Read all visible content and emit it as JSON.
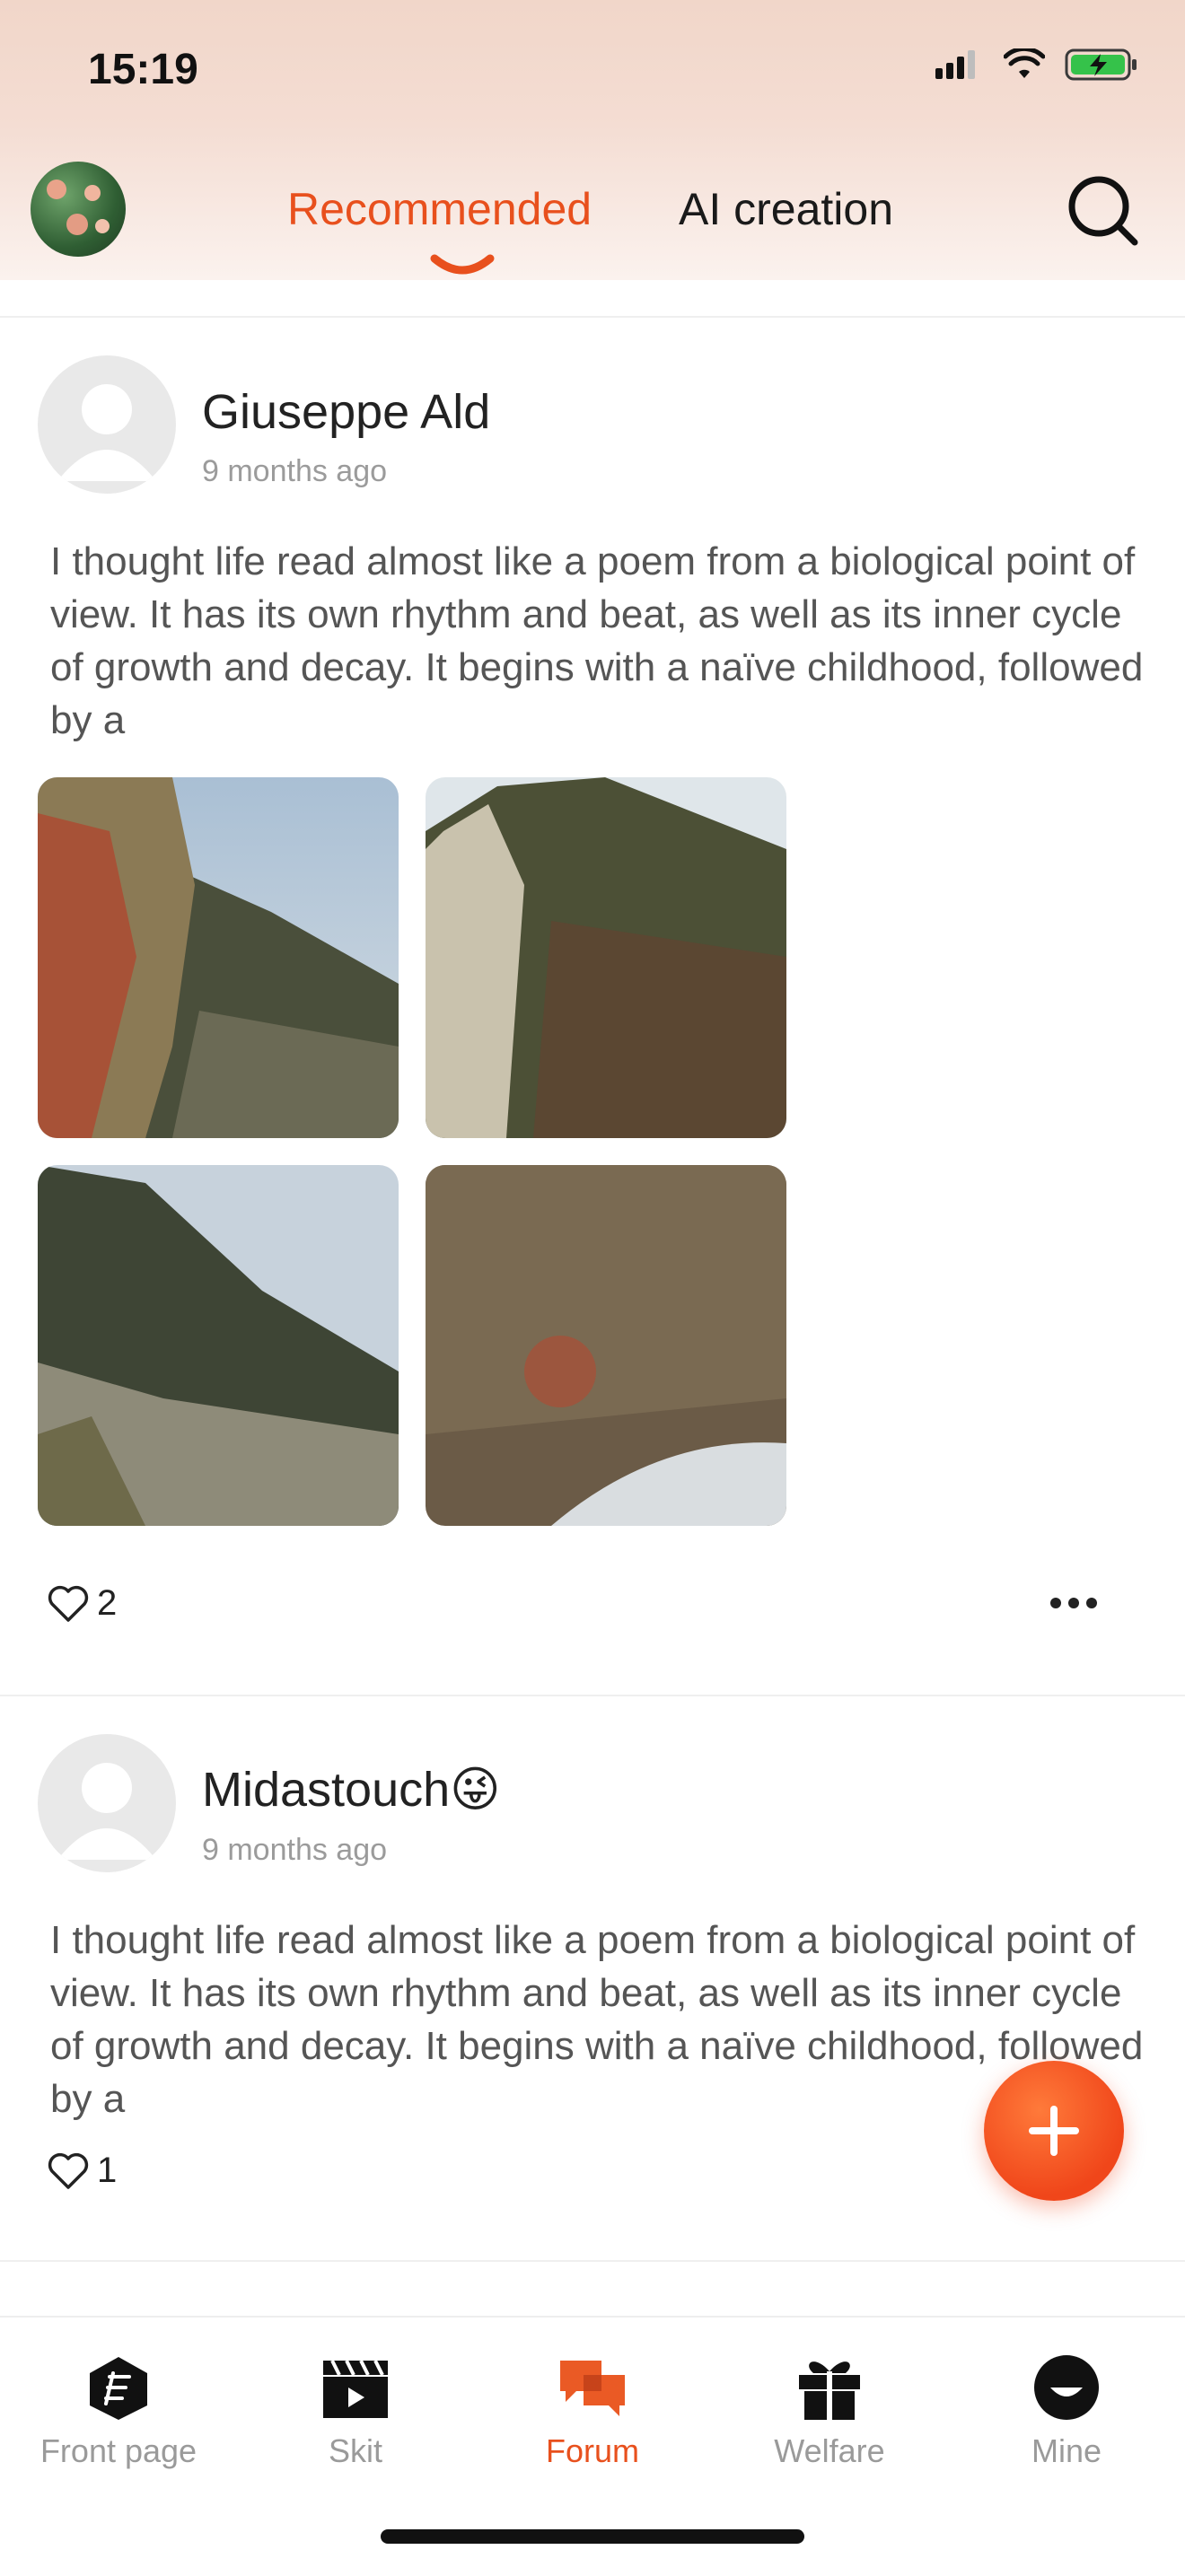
{
  "status_bar": {
    "time": "15:19"
  },
  "header": {
    "tabs": [
      {
        "label": "Recommended",
        "active": true
      },
      {
        "label": "AI creation",
        "active": false
      }
    ],
    "accent_color": "#e8501d"
  },
  "posts": [
    {
      "author": "Giuseppe Ald",
      "time": "9 months ago",
      "text": "I thought life read almost like a poem from a biological point of view. It has its own rhythm and beat, as well as its inner cycle of growth and decay. It begins with a naïve childhood, followed by a",
      "likes": "2"
    },
    {
      "author": "Midastouch😜",
      "time": "9 months ago",
      "text": "I thought life read almost like a poem from a biological point of view. It has its own rhythm and beat, as well as its inner cycle of growth and decay. It begins with a naïve childhood, followed by a",
      "likes": "1"
    }
  ],
  "bottom_nav": [
    {
      "label": "Front page",
      "icon": "front-page-icon"
    },
    {
      "label": "Skit",
      "icon": "clapperboard-icon"
    },
    {
      "label": "Forum",
      "icon": "chat-bubbles-icon",
      "active": true
    },
    {
      "label": "Welfare",
      "icon": "gift-icon"
    },
    {
      "label": "Mine",
      "icon": "profile-icon"
    }
  ]
}
